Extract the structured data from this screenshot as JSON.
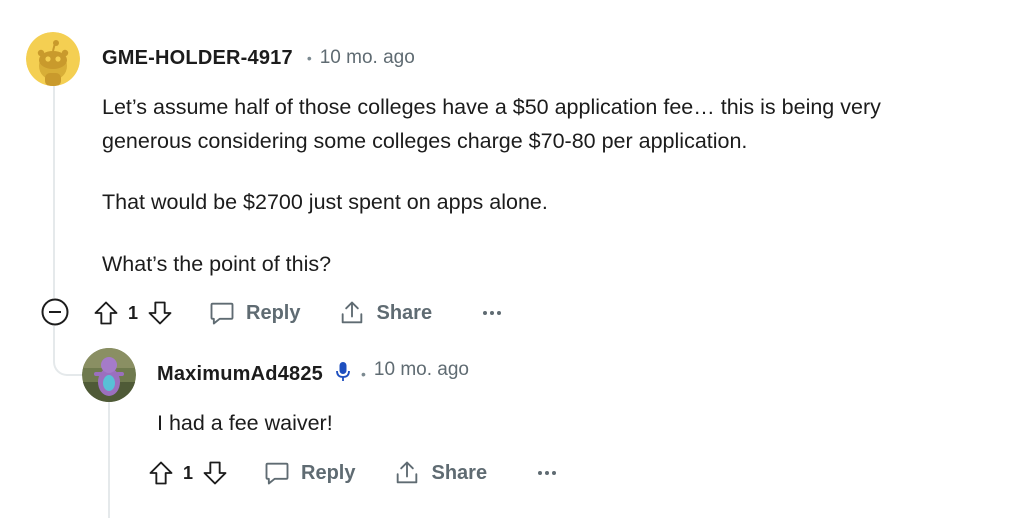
{
  "comment": {
    "username": "GME-HOLDER-4917",
    "separator": "•",
    "time": "10 mo. ago",
    "paragraphs": [
      "Let’s assume half of those colleges have a $50 application fee… this is being very",
      "generous considering some colleges charge $70-80 per application.",
      "That would be $2700 just spent on apps alone.",
      "What’s the point of this?"
    ],
    "votes": "1",
    "reply_label": "Reply",
    "share_label": "Share"
  },
  "reply": {
    "username": "MaximumAd4825",
    "separator": "•",
    "time": "10 mo. ago",
    "text": "I had a fee waiver!",
    "votes": "1",
    "reply_label": "Reply",
    "share_label": "Share"
  },
  "colors": {
    "thread_line": "#e5e9eb",
    "avatar_yellow": "#f4cf52",
    "mic_blue": "#1e4fbf",
    "meta_gray": "#5f6b72"
  },
  "icons": {
    "collapse": "minus-circle-icon",
    "upvote": "arrow-up-outline-icon",
    "downvote": "arrow-down-outline-icon",
    "reply": "speech-bubble-icon",
    "share": "share-upload-icon",
    "more": "ellipsis-icon",
    "badge": "microphone-icon"
  }
}
